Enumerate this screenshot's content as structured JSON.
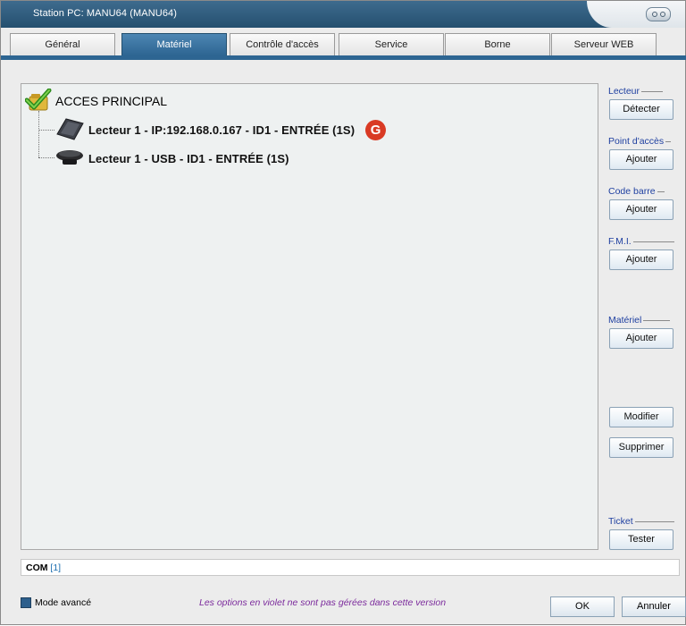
{
  "window": {
    "title": "Station PC: MANU64 (MANU64)"
  },
  "tabs": [
    {
      "label": "Général"
    },
    {
      "label": "Matériel"
    },
    {
      "label": "Contrôle d'accès"
    },
    {
      "label": "Service"
    },
    {
      "label": "Borne"
    },
    {
      "label": "Serveur WEB"
    }
  ],
  "active_tab": "Matériel",
  "tree": {
    "root": "ACCES PRINCIPAL",
    "children": [
      {
        "label": "Lecteur 1 - IP:192.168.0.167 - ID1 - ENTRÉE (1S)",
        "badge": "G",
        "icon": "network-reader-icon"
      },
      {
        "label": "Lecteur 1 - USB - ID1 - ENTRÉE (1S)",
        "icon": "usb-reader-icon"
      }
    ]
  },
  "side": {
    "lecteur_label": "Lecteur",
    "detecter": "Détecter",
    "point_acces_label": "Point d'accès",
    "ajouter_point": "Ajouter",
    "code_barre_label": "Code barre",
    "ajouter_code": "Ajouter",
    "fmi_label": "F.M.I.",
    "ajouter_fmi": "Ajouter",
    "materiel_label": "Matériel",
    "ajouter_materiel": "Ajouter",
    "modifier": "Modifier",
    "supprimer": "Supprimer",
    "ticket_label": "Ticket",
    "tester": "Tester"
  },
  "com": {
    "label": "COM",
    "value": "[1]"
  },
  "footer": {
    "mode_avance": "Mode avancé",
    "notice": "Les options en violet ne sont pas gérées dans cette version",
    "ok": "OK",
    "annuler": "Annuler"
  },
  "colors": {
    "accent": "#2d6592",
    "notice": "#7b2a9c",
    "badge": "#d93a24",
    "section_label": "#1e3fa0"
  }
}
